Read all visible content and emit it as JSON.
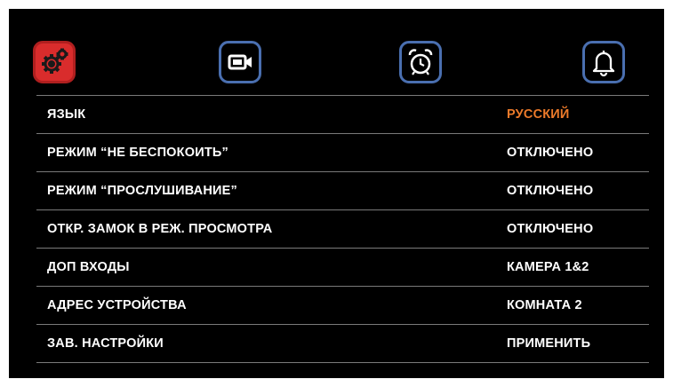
{
  "tabs": [
    {
      "icon": "gears-icon",
      "active": true
    },
    {
      "icon": "camera-icon",
      "active": false
    },
    {
      "icon": "alarm-clock-icon",
      "active": false
    },
    {
      "icon": "bell-icon",
      "active": false
    }
  ],
  "colors": {
    "background": "#000000",
    "active_tab": "#d92c2c",
    "tab_border": "#4a6fb0",
    "accent": "#ec7a2a",
    "text": "#ffffff",
    "divider": "#7a7a7a"
  },
  "settings": [
    {
      "label": "ЯЗЫК",
      "value": "РУССКИЙ"
    },
    {
      "label": "РЕЖИМ “НЕ БЕСПОКОИТЬ”",
      "value": "ОТКЛЮЧЕНО"
    },
    {
      "label": "РЕЖИМ “ПРОСЛУШИВАНИЕ”",
      "value": "ОТКЛЮЧЕНО"
    },
    {
      "label": "ОТКР. ЗАМОК В РЕЖ. ПРОСМОТРА",
      "value": "ОТКЛЮЧЕНО"
    },
    {
      "label": "ДОП ВХОДЫ",
      "value": "КАМЕРА 1&2"
    },
    {
      "label": "АДРЕС УСТРОЙСТВА",
      "value": "КОМНАТА 2"
    },
    {
      "label": "ЗАВ. НАСТРОЙКИ",
      "value": "ПРИМЕНИТЬ"
    }
  ]
}
